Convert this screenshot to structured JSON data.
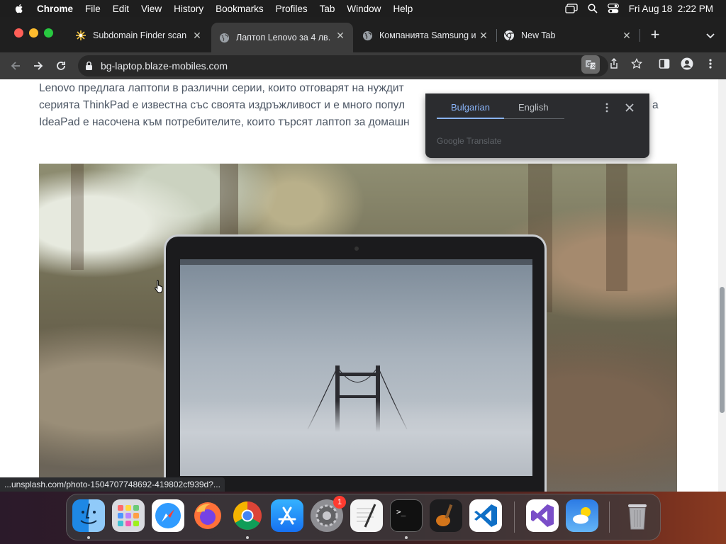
{
  "menubar": {
    "app": "Chrome",
    "items": [
      "File",
      "Edit",
      "View",
      "History",
      "Bookmarks",
      "Profiles",
      "Tab",
      "Window",
      "Help"
    ],
    "clock": "Fri Aug 18  2:22 PM"
  },
  "tabs": [
    {
      "title": "Subdomain Finder scan",
      "icon": "subdomain-finder-icon",
      "active": false
    },
    {
      "title": "Лаптоп Lenovo за 4 лв.",
      "icon": "globe-icon",
      "active": true
    },
    {
      "title": "Компанията Samsung и",
      "icon": "globe-icon",
      "active": false
    },
    {
      "title": "New Tab",
      "icon": "chrome-icon",
      "active": false
    }
  ],
  "toolbar": {
    "url": "bg-laptop.blaze-mobiles.com"
  },
  "page": {
    "paragraph_lines": [
      "Lenovo предлага лаптопи в различни серии, които отговарят на нуждит",
      "серията ThinkPad е известна със своята издръжливост и е много попул",
      "IdeaPad е насочена към потребителите, които търсят лаптоп за домашн"
    ],
    "paragraph_line2_tail": "а"
  },
  "translate_popup": {
    "tab_source": "Bulgarian",
    "tab_target": "English",
    "footer": "Google Translate"
  },
  "status_bar": {
    "text": "...unsplash.com/photo-1504707748692-419802cf939d?..."
  },
  "dock": {
    "apps": [
      "Finder",
      "Launchpad",
      "Safari",
      "Firefox",
      "Chrome",
      "App Store",
      "System Settings",
      "TextEdit",
      "Terminal",
      "GarageBand",
      "Visual Studio Code",
      "Visual Studio",
      "Weather",
      "Trash"
    ],
    "settings_badge": "1"
  },
  "colors": {
    "active_tab": "#3c3c3c",
    "tabstrip": "#1f1f1f",
    "translate_accent": "#8ab4f8"
  }
}
